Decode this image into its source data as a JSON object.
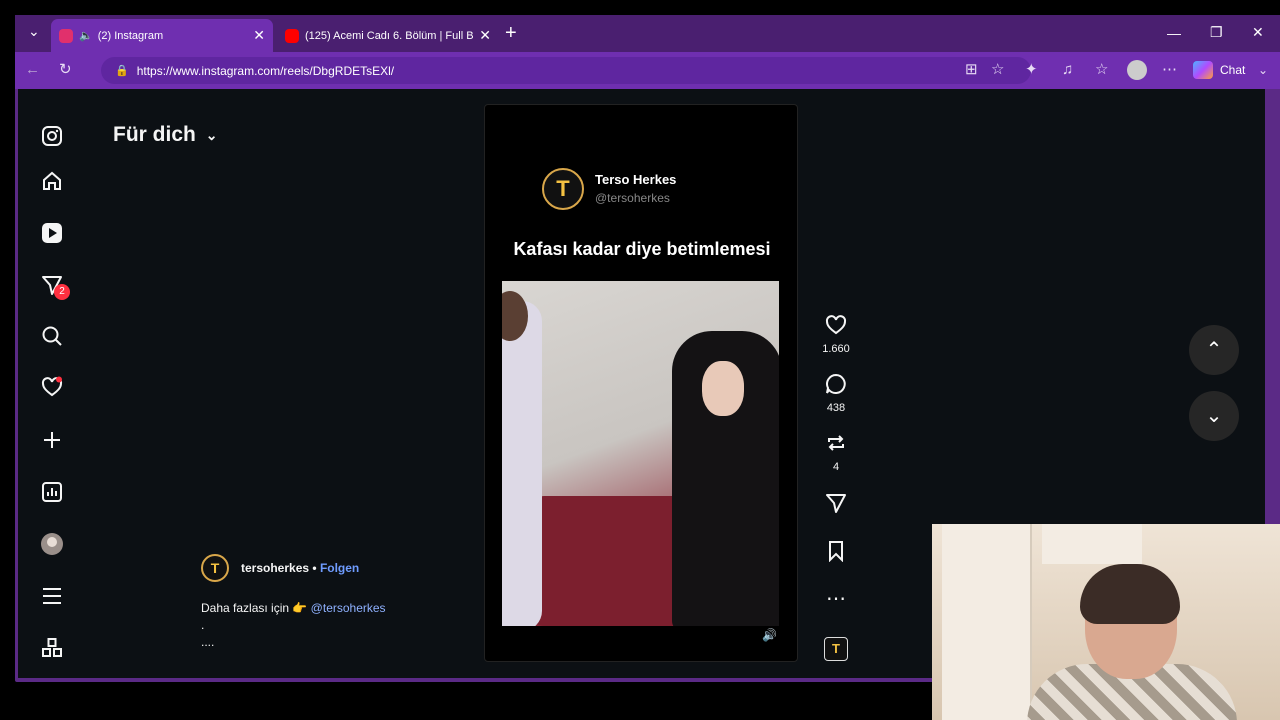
{
  "browser": {
    "tabs": [
      {
        "title": "(2) Instagram",
        "favicon_color": "#e1306c",
        "active": true
      },
      {
        "title": "(125) Acemi Cadı 6. Bölüm | Full Bö",
        "favicon_color": "#ff0000",
        "active": false
      }
    ],
    "url": "https://www.instagram.com/reels/DbgRDETsEXl/",
    "chat_label": "Chat"
  },
  "sidebar": {
    "notification_badge": "2",
    "items": [
      "instagram-logo",
      "home",
      "reels",
      "messages",
      "search",
      "notifications",
      "create",
      "dashboard",
      "profile",
      "more",
      "also-from-meta"
    ]
  },
  "feed": {
    "title": "Für dich"
  },
  "reel": {
    "author_name": "Terso Herkes",
    "author_handle": "@tersoherkes",
    "avatar_letter": "T",
    "caption": "Kafası kadar diye betimlemesi"
  },
  "actions": {
    "likes": "1.660",
    "comments": "438",
    "reposts": "4"
  },
  "post": {
    "username": "tersoherkes",
    "separator": "•",
    "follow_label": "Folgen",
    "description_prefix": "Daha fazlası için 👉",
    "mention": "@tersoherkes",
    "dot_line": ".",
    "more": "...."
  }
}
